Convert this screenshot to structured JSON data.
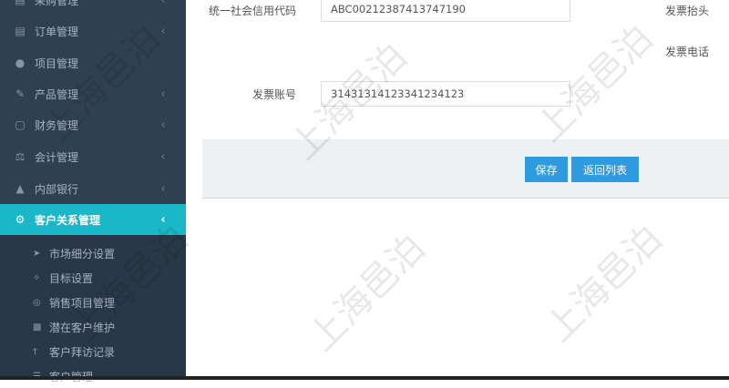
{
  "sidebar": {
    "items": [
      {
        "label": "采购管理",
        "icon": "cart-icon"
      },
      {
        "label": "订单管理",
        "icon": "cart-icon"
      },
      {
        "label": "项目管理",
        "icon": "project-icon"
      },
      {
        "label": "产品管理",
        "icon": "edit-icon"
      },
      {
        "label": "财务管理",
        "icon": "money-icon"
      },
      {
        "label": "会计管理",
        "icon": "scale-icon"
      },
      {
        "label": "内部银行",
        "icon": "bank-icon"
      },
      {
        "label": "客户关系管理",
        "icon": "gears-icon"
      }
    ],
    "submenu": [
      {
        "label": "市场细分设置",
        "icon": "send-icon"
      },
      {
        "label": "目标设置",
        "icon": "crosshair-icon"
      },
      {
        "label": "销售项目管理",
        "icon": "circle-icon"
      },
      {
        "label": "潜在客户维护",
        "icon": "binoculars-icon"
      },
      {
        "label": "客户拜访记录",
        "icon": "user-icon"
      },
      {
        "label": "客户管理",
        "icon": "list-icon"
      }
    ],
    "active_color": "#1ab7c9"
  },
  "form": {
    "credit_code_label": "统一社会信用代码",
    "credit_code_value": "ABC00212387413747190",
    "invoice_header_label": "发票抬头",
    "invoice_phone_label": "发票电话",
    "invoice_account_label": "发票账号",
    "invoice_account_value": "31431314123341234123"
  },
  "buttons": {
    "save_label": "保存",
    "back_label": "返回列表"
  },
  "watermark_text": "上海邑泊"
}
